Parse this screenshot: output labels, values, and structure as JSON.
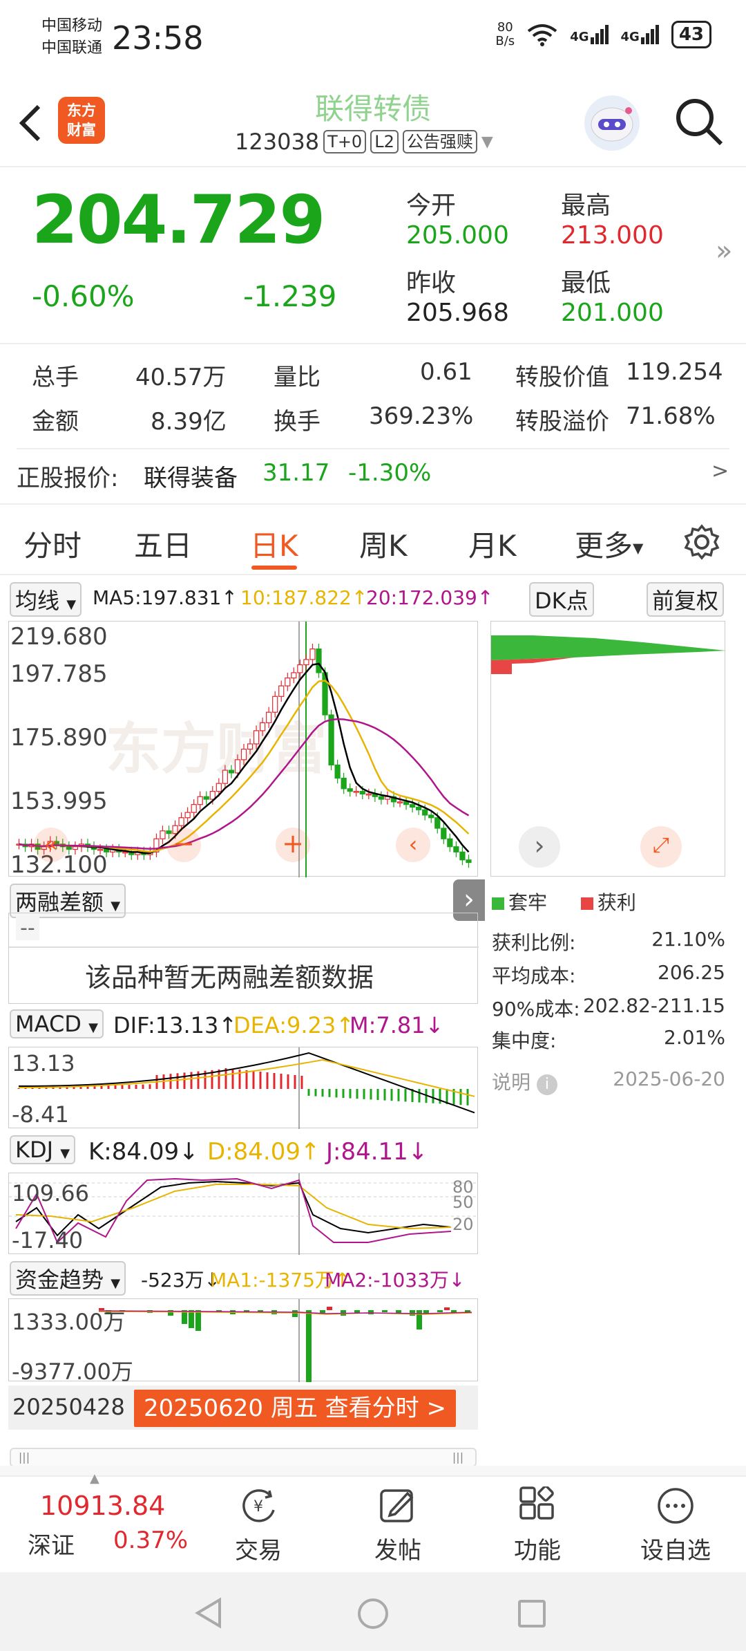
{
  "status": {
    "carrier1": "中国移动",
    "carrier2": "中国联通",
    "time": "23:58",
    "net_speed": "80\nB/s",
    "net_speed_top": "80",
    "net_speed_bottom": "B/s",
    "sig1": "4G",
    "sig2": "4G",
    "battery": "43"
  },
  "header": {
    "logo_line1": "东方",
    "logo_line2": "财富",
    "title": "联得转债",
    "code": "123038",
    "tag1": "T+0",
    "tag2": "L2",
    "tag3": "公告强赎"
  },
  "quote": {
    "price": "204.729",
    "pct": "-0.60%",
    "chg": "-1.239",
    "open_label": "今开",
    "open": "205.000",
    "high_label": "最高",
    "high": "213.000",
    "prev_label": "昨收",
    "prev": "205.968",
    "low_label": "最低",
    "low": "201.000"
  },
  "stats": {
    "vol_label": "总手",
    "vol": "40.57万",
    "ratio_label": "量比",
    "ratio": "0.61",
    "conv_val_label": "转股价值",
    "conv_val": "119.254",
    "amt_label": "金额",
    "amt": "8.39亿",
    "turn_label": "换手",
    "turn": "369.23%",
    "premium_label": "转股溢价",
    "premium": "71.68%"
  },
  "stock": {
    "label": "正股报价:",
    "name": "联得装备",
    "price": "31.17",
    "pct": "-1.30%",
    "arrow": ">"
  },
  "tabs": [
    "分时",
    "五日",
    "日K",
    "周K",
    "月K",
    "更多"
  ],
  "kline": {
    "ma_select": "均线",
    "ma5": "MA5:197.831↑",
    "ma10": "10:187.822↑",
    "ma20": "20:172.039↑",
    "dk_btn": "DK点",
    "fq_btn": "前复权",
    "y_labels": [
      "219.680",
      "197.785",
      "175.890",
      "153.995",
      "132.100"
    ],
    "watermark": "东方财富"
  },
  "margin": {
    "select": "两融差额",
    "dash": "--",
    "empty": "该品种暂无两融差额数据"
  },
  "macd": {
    "select": "MACD",
    "dif": "DIF:13.13↑",
    "dea": "DEA:9.23↑",
    "m": "M:7.81↓",
    "top": "13.13",
    "bottom": "-8.41"
  },
  "kdj": {
    "select": "KDJ",
    "k": "K:84.09↓",
    "d": "D:84.09↑",
    "j": "J:84.11↓",
    "top": "109.66",
    "bottom": "-17.40",
    "lv80": "80",
    "lv50": "50",
    "lv20": "20"
  },
  "fund": {
    "select": "资金趋势",
    "val": "-523万↓",
    "ma1": "MA1:-1375万↑",
    "ma2": "MA2:-1033万↓",
    "top": "1333.00万",
    "bottom": "-9377.00万"
  },
  "date_bar": {
    "start": "20250428",
    "current": "20250620 周五 查看分时 >"
  },
  "chips": {
    "legend_trap": "套牢",
    "legend_profit": "获利",
    "rows": [
      {
        "label": "获利比例:",
        "value": "21.10%"
      },
      {
        "label": "平均成本:",
        "value": "206.25"
      },
      {
        "label": "90%成本:",
        "value": "202.82-211.15"
      },
      {
        "label": "集中度:",
        "value": "2.01%"
      }
    ],
    "note_label": "说明",
    "date": "2025-06-20"
  },
  "bottom_nav": {
    "index_value": "10913.84",
    "index_name": "深证",
    "index_pct": "0.37%",
    "items": [
      "交易",
      "发帖",
      "功能",
      "设自选"
    ]
  },
  "colors": {
    "up": "#e0282e",
    "down": "#1aa51a",
    "accent": "#f05a22",
    "ma5": "#000000",
    "ma10": "#e8b400",
    "ma20": "#b0158c"
  }
}
